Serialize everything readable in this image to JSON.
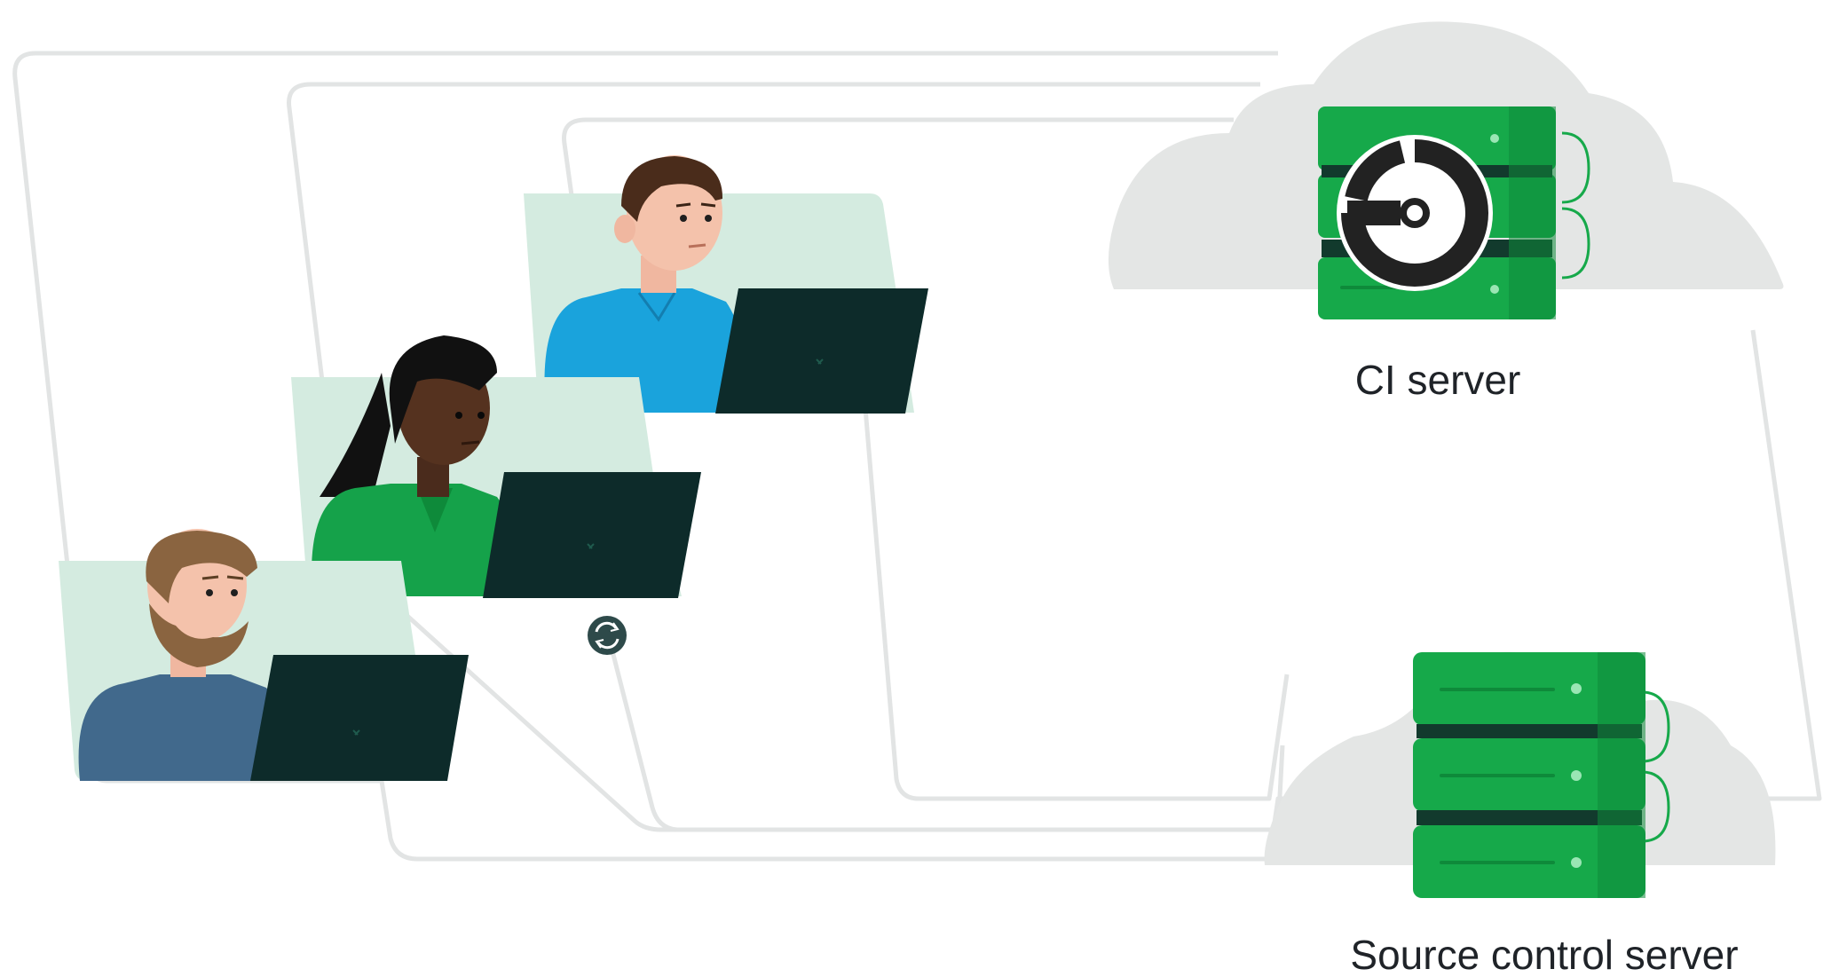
{
  "nodes": {
    "ci_server": {
      "label": "CI server"
    },
    "source_control_server": {
      "label": "Source control server"
    }
  },
  "developers": [
    {
      "role": "developer",
      "shirt": "blue"
    },
    {
      "role": "developer",
      "shirt": "green"
    },
    {
      "role": "developer",
      "shirt": "slate"
    }
  ],
  "colors": {
    "server_green": "#16a94a",
    "server_green_dark": "#0e8a3a",
    "server_stripe": "#123a2d",
    "cloud": "#e4e6e5",
    "panel_mint": "#d4ebe0",
    "laptop": "#0d2b2a",
    "connector_line": "#e2e4e4",
    "ci_logo_dark": "#222222",
    "ci_logo_light": "#ffffff"
  },
  "icons": [
    "circleci-logo-icon",
    "server-rack-icon",
    "cloud-icon",
    "laptop-icon",
    "sync-icon"
  ]
}
